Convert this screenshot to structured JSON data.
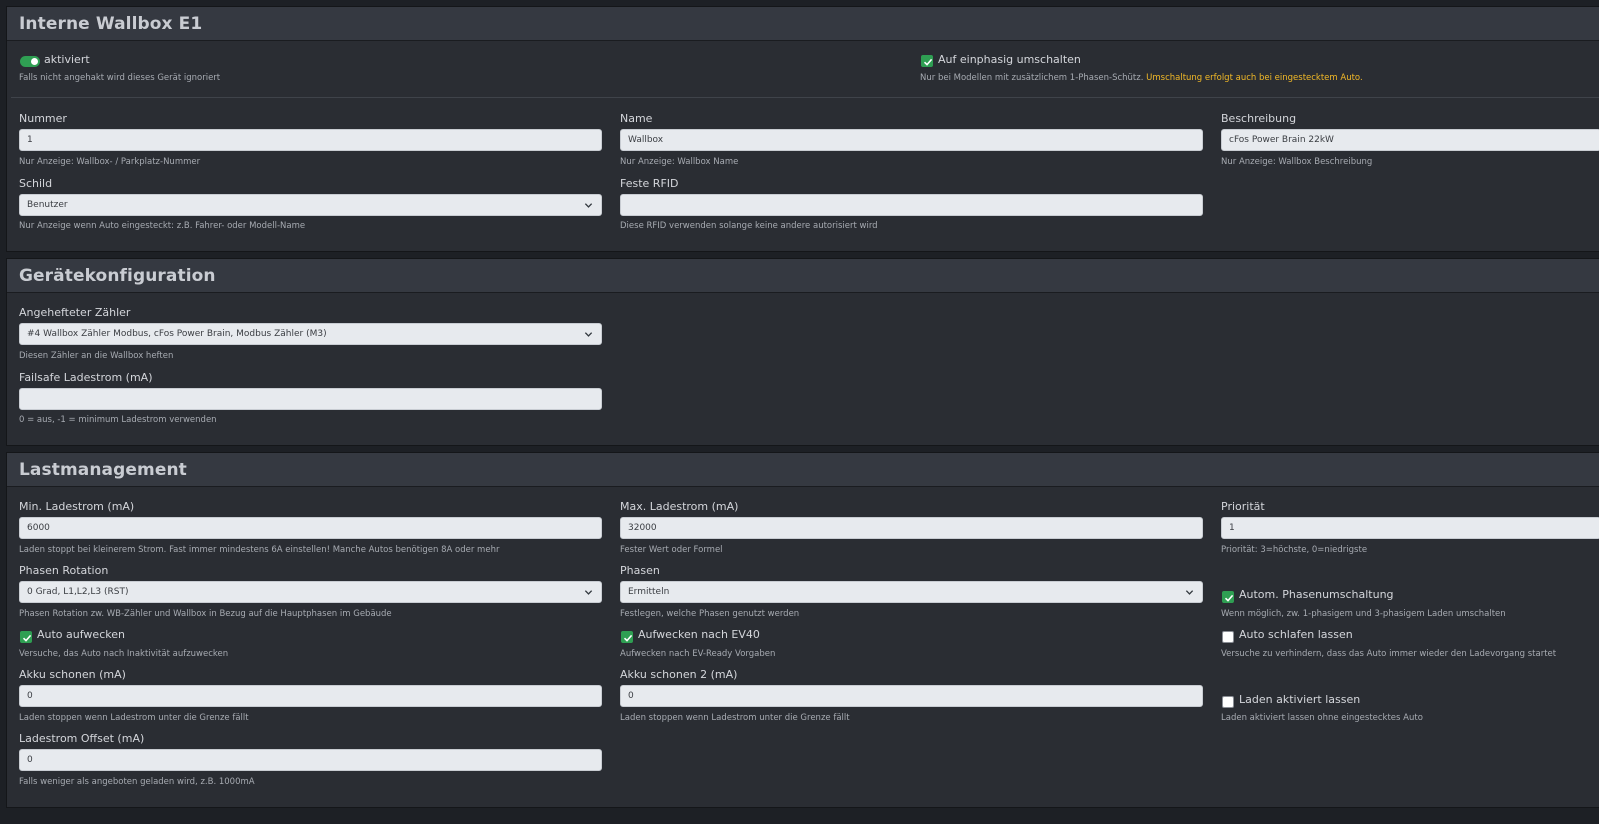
{
  "wallbox": {
    "title": "Interne Wallbox E1",
    "enabled": {
      "label": "aktiviert",
      "hint": "Falls nicht angehakt wird dieses Gerät ignoriert",
      "checked": true
    },
    "single_phase": {
      "label": "Auf einphasig umschalten",
      "hint": "Nur bei Modellen mit zusätzlichem 1-Phasen-Schütz.",
      "warning": "Umschaltung erfolgt auch bei eingestecktem Auto.",
      "checked": true
    },
    "number": {
      "label": "Nummer",
      "value": "1",
      "hint": "Nur Anzeige: Wallbox- / Parkplatz-Nummer"
    },
    "name": {
      "label": "Name",
      "value": "Wallbox",
      "hint": "Nur Anzeige: Wallbox Name"
    },
    "description": {
      "label": "Beschreibung",
      "value": "cFos Power Brain 22kW",
      "hint": "Nur Anzeige: Wallbox Beschreibung"
    },
    "sign": {
      "label": "Schild",
      "value": "Benutzer",
      "hint": "Nur Anzeige wenn Auto eingesteckt: z.B. Fahrer- oder Modell-Name"
    },
    "rfid": {
      "label": "Feste RFID",
      "value": "",
      "hint": "Diese RFID verwenden solange keine andere autorisiert wird"
    }
  },
  "device_config": {
    "title": "Gerätekonfiguration",
    "meter": {
      "label": "Angehefteter Zähler",
      "value": "#4 Wallbox Zähler Modbus, cFos Power Brain, Modbus Zähler (M3)",
      "hint": "Diesen Zähler an die Wallbox heften"
    },
    "failsafe": {
      "label": "Failsafe Ladestrom (mA)",
      "value": "",
      "hint": "0 = aus, -1 = minimum Ladestrom verwenden"
    }
  },
  "load_mgmt": {
    "title": "Lastmanagement",
    "min_current": {
      "label": "Min. Ladestrom (mA)",
      "value": "6000",
      "hint": "Laden stoppt bei kleinerem Strom. Fast immer mindestens 6A einstellen! Manche Autos benötigen 8A oder mehr"
    },
    "max_current": {
      "label": "Max. Ladestrom (mA)",
      "value": "32000",
      "hint": "Fester Wert oder Formel"
    },
    "priority": {
      "label": "Priorität",
      "value": "1",
      "hint": "Priorität: 3=höchste, 0=niedrigste"
    },
    "phase_rotation": {
      "label": "Phasen Rotation",
      "value": "0 Grad, L1,L2,L3 (RST)",
      "hint": "Phasen Rotation zw. WB-Zähler und Wallbox in Bezug auf die Hauptphasen im Gebäude"
    },
    "phases": {
      "label": "Phasen",
      "value": "Ermitteln",
      "hint": "Festlegen, welche Phasen genutzt werden"
    },
    "auto_phase_switch": {
      "label": "Autom. Phasenumschaltung",
      "hint": "Wenn möglich, zw. 1-phasigem und 3-phasigem Laden umschalten",
      "checked": true
    },
    "auto_wake": {
      "label": "Auto aufwecken",
      "hint": "Versuche, das Auto nach Inaktivität aufzuwecken",
      "checked": true
    },
    "wake_ev40": {
      "label": "Aufwecken nach EV40",
      "hint": "Aufwecken nach EV-Ready Vorgaben",
      "checked": true
    },
    "let_sleep": {
      "label": "Auto schlafen lassen",
      "hint": "Versuche zu verhindern, dass das Auto immer wieder den Ladevorgang startet",
      "checked": false
    },
    "battery_save": {
      "label": "Akku schonen (mA)",
      "value": "0",
      "hint": "Laden stoppen wenn Ladestrom unter die Grenze fällt"
    },
    "battery_save2": {
      "label": "Akku schonen 2 (mA)",
      "value": "0",
      "hint": "Laden stoppen wenn Ladestrom unter die Grenze fällt"
    },
    "keep_enabled": {
      "label": "Laden aktiviert lassen",
      "hint": "Laden aktiviert lassen ohne eingestecktes Auto",
      "checked": false
    },
    "offset": {
      "label": "Ladestrom Offset (mA)",
      "value": "0",
      "hint": "Falls weniger als angeboten geladen wird, z.B. 1000mA"
    }
  }
}
